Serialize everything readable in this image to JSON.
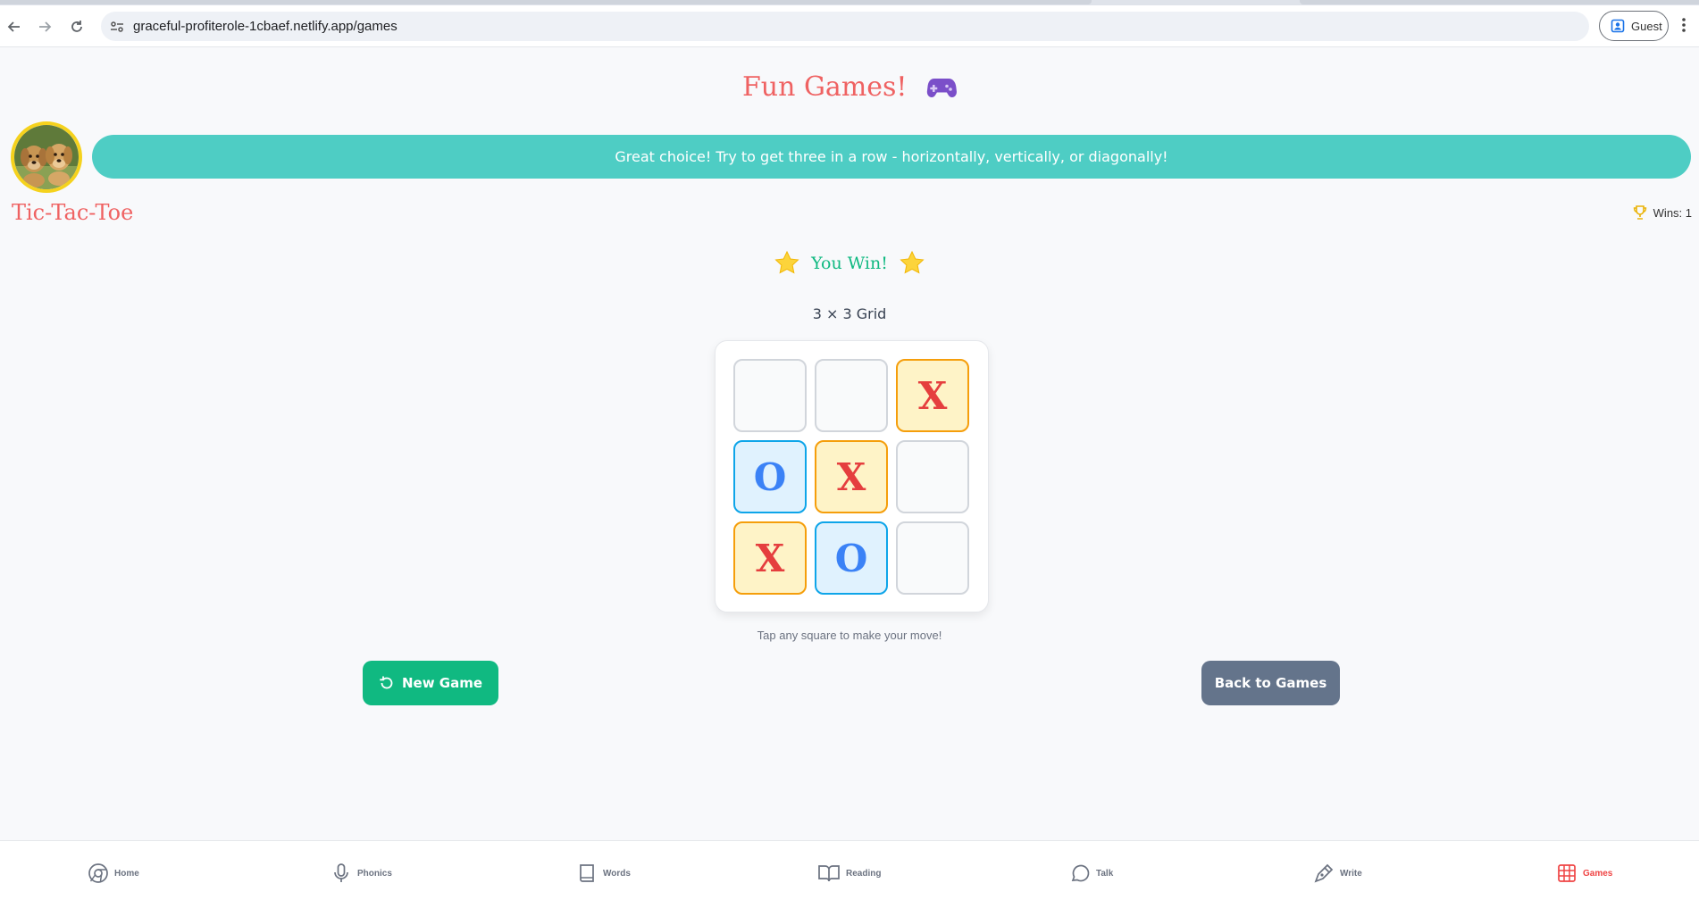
{
  "browser": {
    "url": "graceful-profiterole-1cbaef.netlify.app/games",
    "profile_label": "Guest"
  },
  "header": {
    "title": "Fun Games!",
    "title_icon": "gamepad-icon"
  },
  "assistant": {
    "avatar": "puppies-avatar",
    "message": "Great choice! Try to get three in a row - horizontally, vertically, or diagonally!"
  },
  "game": {
    "name": "Tic-Tac-Toe",
    "wins_label": "Wins: 1",
    "status": "You Win!",
    "grid_label": "3 × 3 Grid",
    "board": [
      "",
      "",
      "X",
      "O",
      "X",
      "",
      "X",
      "O",
      ""
    ],
    "hint": "Tap any square to make your move!"
  },
  "actions": {
    "new_game": "New Game",
    "back": "Back to Games"
  },
  "bottom_nav": [
    {
      "label": "Home",
      "icon": "home-icon"
    },
    {
      "label": "Phonics",
      "icon": "microphone-icon"
    },
    {
      "label": "Words",
      "icon": "book-icon"
    },
    {
      "label": "Reading",
      "icon": "open-book-icon"
    },
    {
      "label": "Talk",
      "icon": "chat-bubble-icon"
    },
    {
      "label": "Write",
      "icon": "pen-icon"
    },
    {
      "label": "Games",
      "icon": "grid-icon",
      "active": true
    }
  ],
  "colors": {
    "title": "#ef6262",
    "bubble": "#4ecdc4",
    "win": "#10b981",
    "x_mark": "#e53e3e",
    "o_mark": "#3b82f6",
    "new_game_button": "#10b981",
    "back_button": "#64748b",
    "active_nav": "#ef4444"
  }
}
